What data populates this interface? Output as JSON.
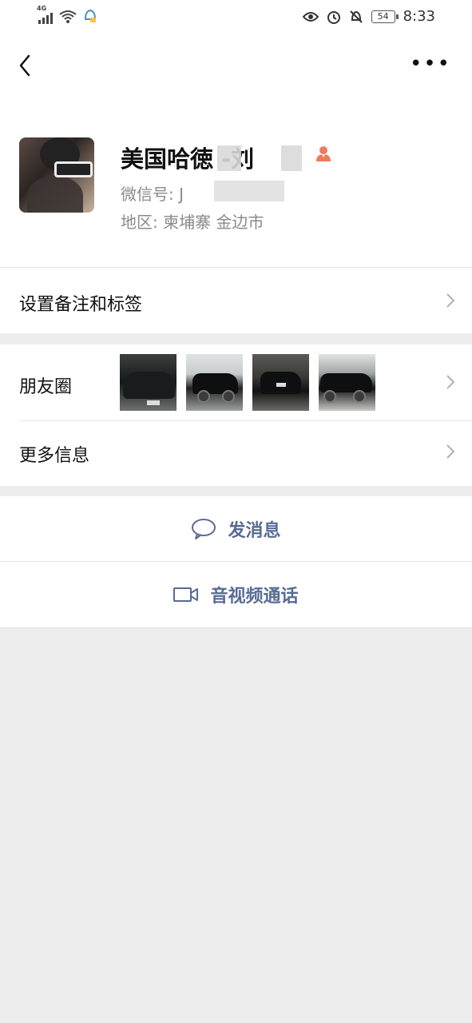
{
  "status_bar": {
    "network": "4G",
    "battery": "54",
    "time": "8:33"
  },
  "nav": {
    "back_icon": "chevron-left-icon",
    "more_icon": "more-dots-icon"
  },
  "profile": {
    "name": "美国哈徳  -刘",
    "wechat_id_label": "微信号: J",
    "region": "地区:  柬埔寨  金边市"
  },
  "rows": {
    "remark": "设置备注和标签",
    "moments": "朋友圈",
    "more_info": "更多信息"
  },
  "actions": {
    "message": "发消息",
    "call": "音视频通话"
  },
  "colors": {
    "link_blue": "#576b95",
    "background": "#ededed",
    "badge_orange": "#f07a5c"
  }
}
